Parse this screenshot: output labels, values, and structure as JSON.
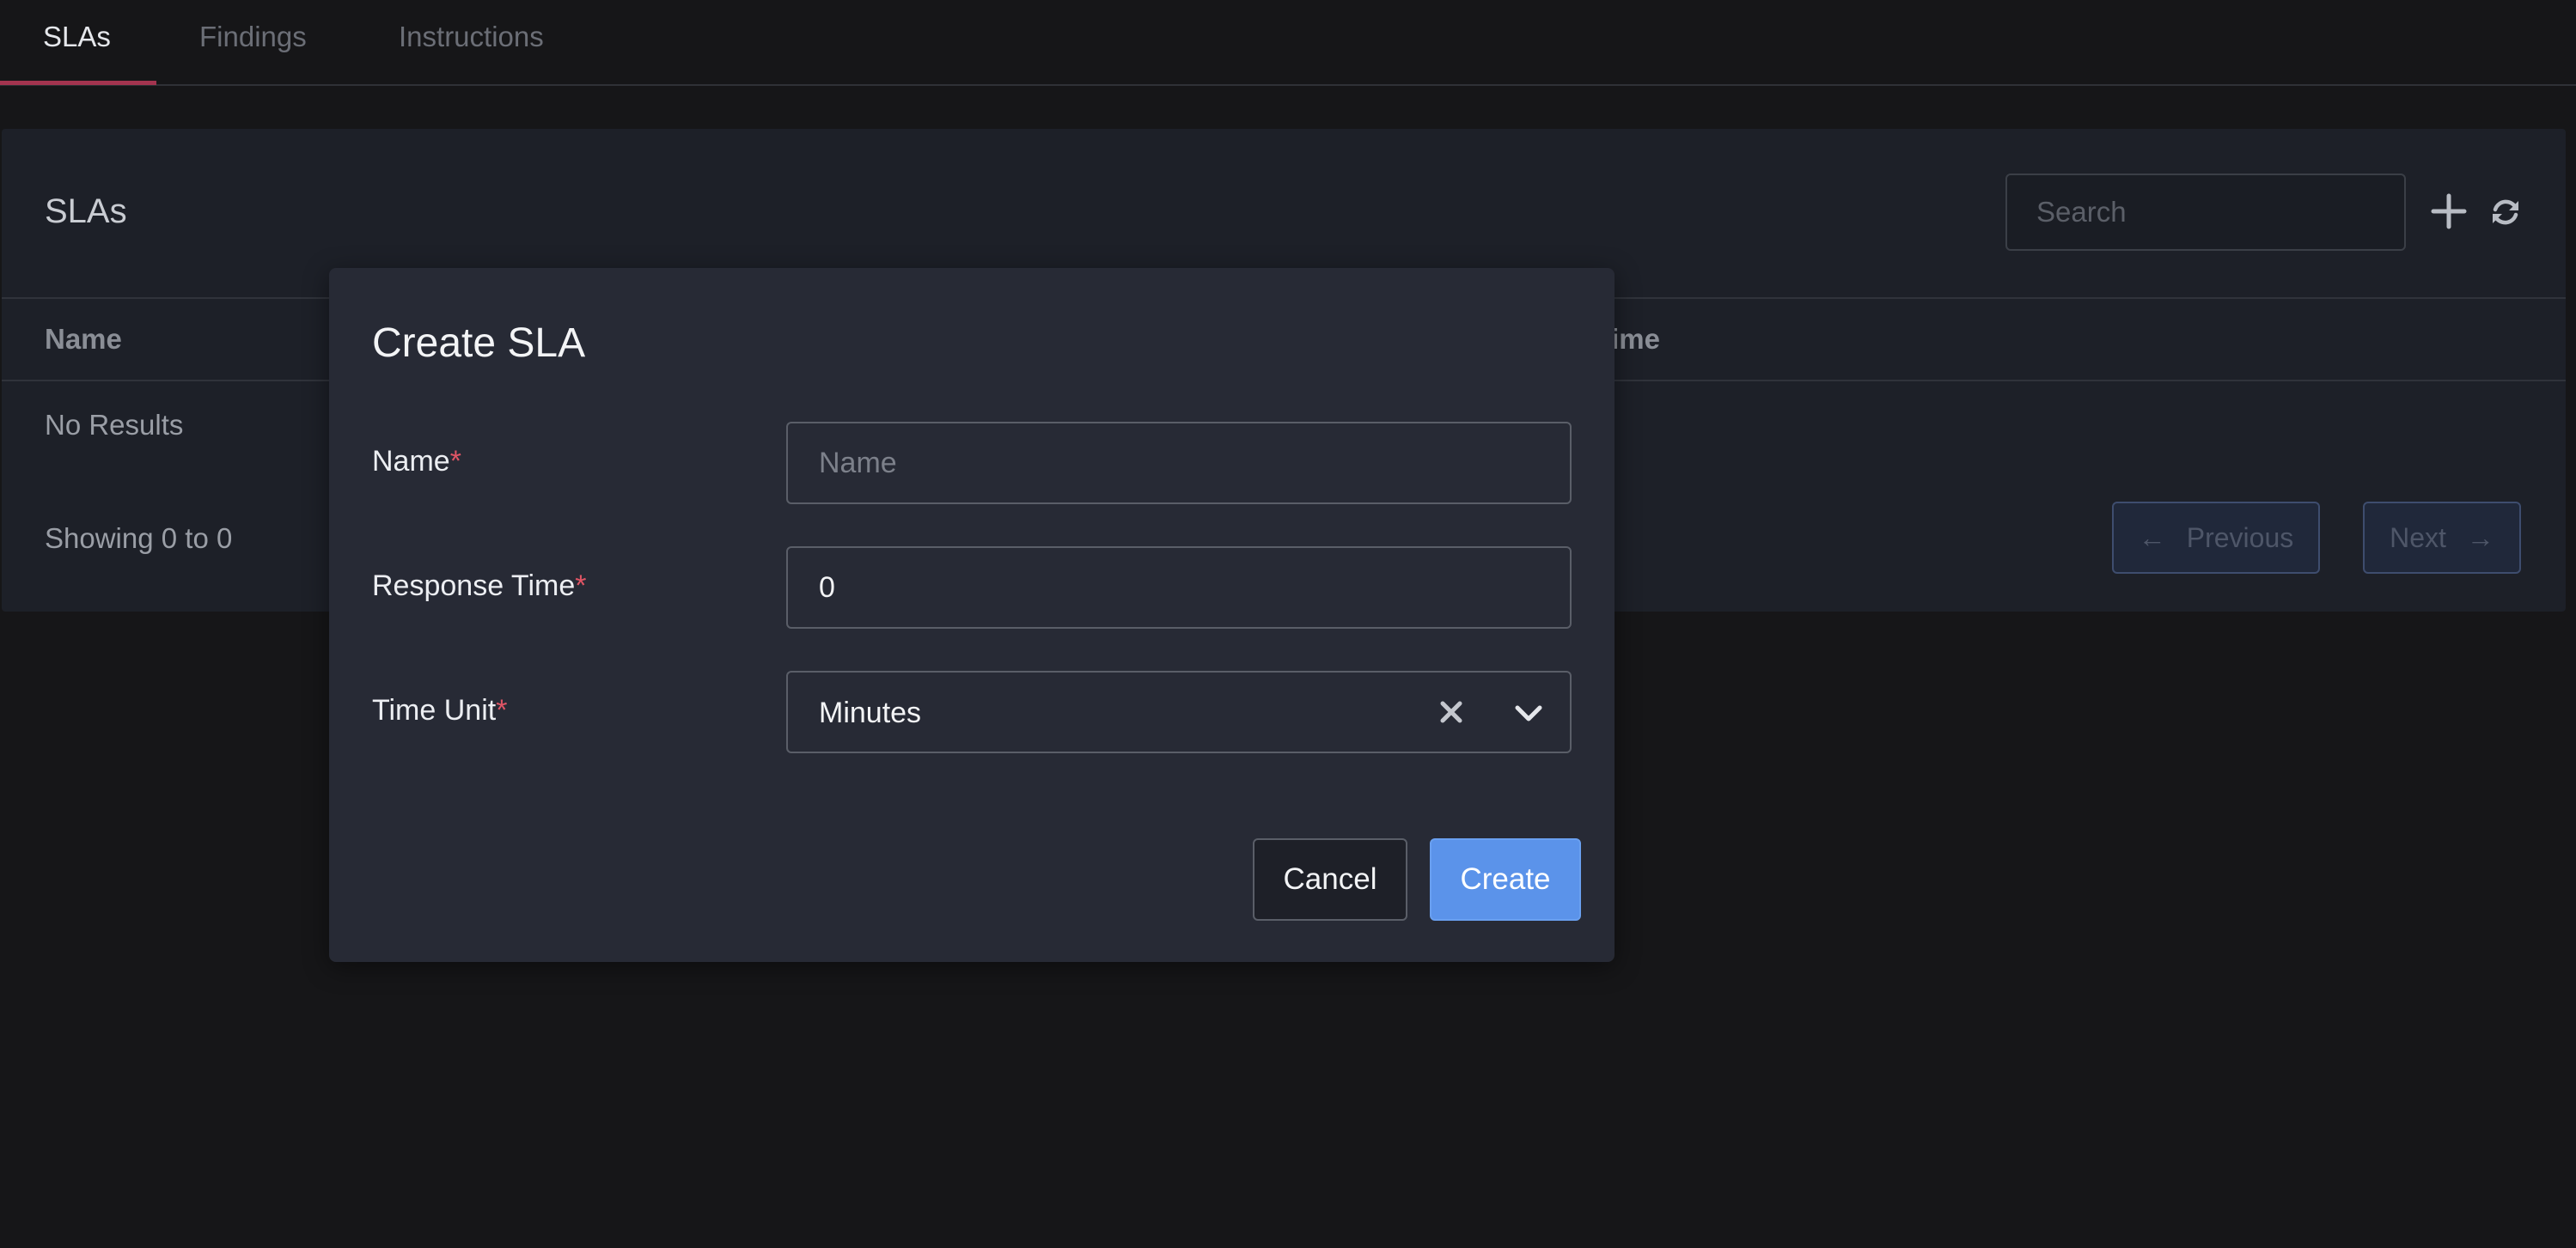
{
  "tabs": [
    {
      "label": "SLAs",
      "active": true
    },
    {
      "label": "Findings",
      "active": false
    },
    {
      "label": "Instructions",
      "active": false
    }
  ],
  "panel": {
    "title": "SLAs",
    "search_placeholder": "Search",
    "columns": [
      "Name",
      "e Time"
    ],
    "empty_text": "No Results",
    "showing_text": "Showing 0 to 0",
    "pagination": {
      "previous_label": "Previous",
      "previous_arrow": "←",
      "next_label": "Next",
      "next_arrow": "→"
    }
  },
  "modal": {
    "title": "Create SLA",
    "required_mark": "*",
    "fields": {
      "name": {
        "label": "Name",
        "value": "",
        "placeholder": "Name"
      },
      "response_time": {
        "label": "Response Time",
        "value": "0"
      },
      "time_unit": {
        "label": "Time Unit",
        "value": "Minutes"
      }
    },
    "cancel_label": "Cancel",
    "create_label": "Create"
  },
  "colors": {
    "background": "#161618",
    "panel": "#1d2028",
    "modal": "#272a35",
    "tab_accent": "#a3344f",
    "primary_button": "#5b93ea",
    "required": "#e05565"
  },
  "icons": [
    "plus-icon",
    "refresh-icon",
    "clear-icon",
    "chevron-down-icon",
    "arrow-left-icon",
    "arrow-right-icon"
  ]
}
